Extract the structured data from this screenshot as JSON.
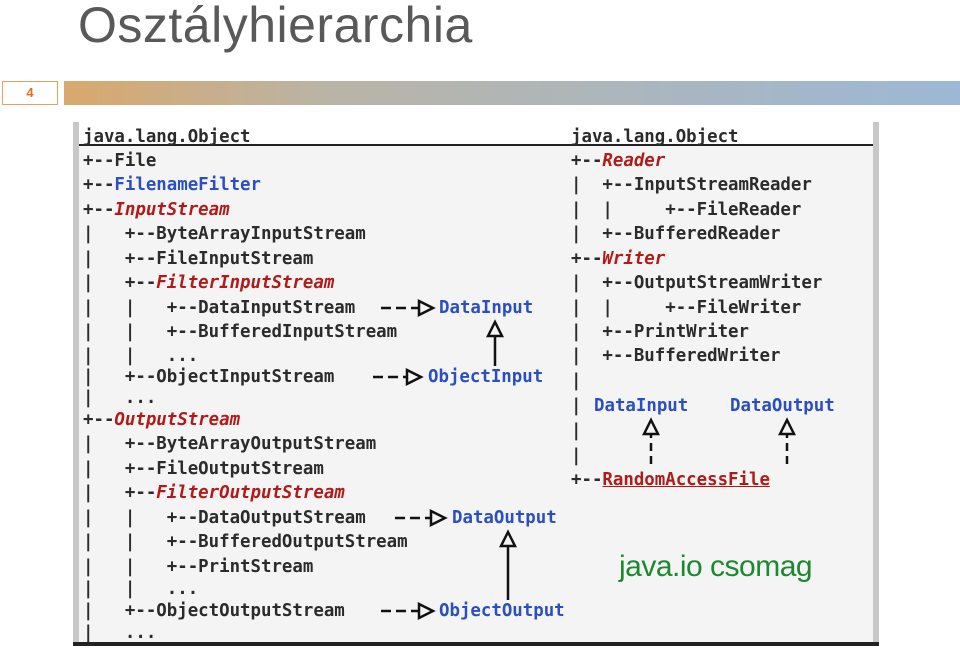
{
  "slide": {
    "title": "Osztályhierarchia",
    "number": "4"
  },
  "left_tree": {
    "lines": [
      {
        "prefix": "java.lang.Object",
        "name": ""
      },
      {
        "prefix": "+--",
        "name": "File"
      },
      {
        "prefix": "+--",
        "name": "FilenameFilter"
      },
      {
        "prefix": "+--",
        "name": "InputStream"
      },
      {
        "prefix": "|   +--",
        "name": "ByteArrayInputStream"
      },
      {
        "prefix": "|   +--",
        "name": "FileInputStream"
      },
      {
        "prefix": "|   +--",
        "name": "FilterInputStream"
      },
      {
        "prefix": "|   |   +--",
        "name": "DataInputStream"
      },
      {
        "prefix": "|   |   +--",
        "name": "BufferedInputStream"
      },
      {
        "prefix": "|   |   ",
        "name": "..."
      },
      {
        "prefix": "|   +--",
        "name": "ObjectInputStream"
      },
      {
        "prefix": "|   ",
        "name": "..."
      },
      {
        "prefix": "+--",
        "name": "OutputStream"
      },
      {
        "prefix": "|   +--",
        "name": "ByteArrayOutputStream"
      },
      {
        "prefix": "|   +--",
        "name": "FileOutputStream"
      },
      {
        "prefix": "|   +--",
        "name": "FilterOutputStream"
      },
      {
        "prefix": "|   |   +--",
        "name": "DataOutputStream"
      },
      {
        "prefix": "|   |   +--",
        "name": "BufferedOutputStream"
      },
      {
        "prefix": "|   |   +--",
        "name": "PrintStream"
      },
      {
        "prefix": "|   |   ",
        "name": "..."
      },
      {
        "prefix": "|   +--",
        "name": "ObjectOutputStream"
      },
      {
        "prefix": "|   ",
        "name": "..."
      }
    ],
    "interfaces": [
      "DataInput",
      "ObjectInput",
      "DataOutput",
      "ObjectOutput"
    ]
  },
  "right_tree": {
    "lines": [
      {
        "prefix": "java.lang.Object",
        "name": ""
      },
      {
        "prefix": "+--",
        "name": "Reader"
      },
      {
        "prefix": "|  +--",
        "name": "InputStreamReader"
      },
      {
        "prefix": "|  |     +--",
        "name": "FileReader"
      },
      {
        "prefix": "|  +--",
        "name": "BufferedReader"
      },
      {
        "prefix": "+--",
        "name": "Writer"
      },
      {
        "prefix": "|  +--",
        "name": "OutputStreamWriter"
      },
      {
        "prefix": "|  |     +--",
        "name": "FileWriter"
      },
      {
        "prefix": "|  +--",
        "name": "PrintWriter"
      },
      {
        "prefix": "|  +--",
        "name": "BufferedWriter"
      },
      {
        "prefix": "|",
        "name": ""
      },
      {
        "prefix": "|",
        "name": ""
      },
      {
        "prefix": "|",
        "name": ""
      },
      {
        "prefix": "|",
        "name": ""
      },
      {
        "prefix": "+--",
        "name": "RandomAccessFile"
      }
    ],
    "interfaces": [
      "DataInput",
      "DataOutput"
    ]
  },
  "package_label": "java.io csomag",
  "colors": {
    "abstract_class": "#b21a1a",
    "interface": "#2b4fc0",
    "package_label": "#1b8a2e",
    "slide_number": "#e07020"
  }
}
